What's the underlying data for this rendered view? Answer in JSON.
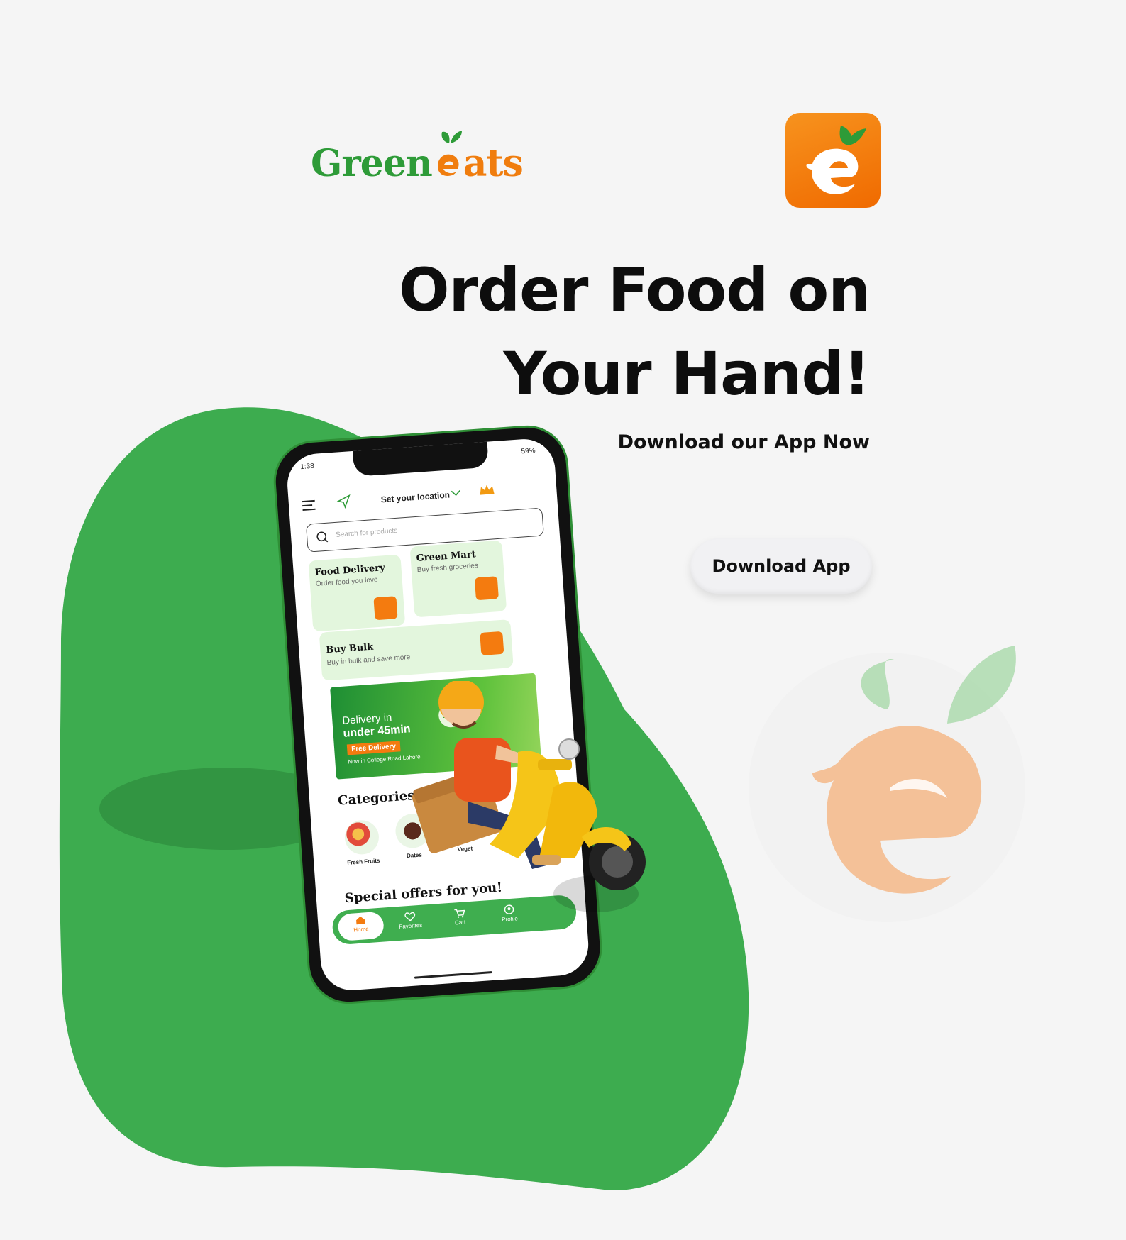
{
  "brand": {
    "wordmark_green": "Green",
    "wordmark_orange": "ats",
    "colors": {
      "green": "#3dac4f",
      "orange": "#f47b0f",
      "dark": "#0d0d0d"
    },
    "logo_icon": "bitten-fruit-e-icon"
  },
  "hero": {
    "headline_line1": "Order Food on",
    "headline_line2": "Your Hand!",
    "subline": "Download our App Now",
    "button_label": "Download App"
  },
  "phone": {
    "status_time": "1:38",
    "status_battery": "59%",
    "location_label": "Set your location",
    "search_placeholder": "Search for products",
    "cards": [
      {
        "title": "Food Delivery",
        "subtitle": "Order food you love"
      },
      {
        "title": "Green Mart",
        "subtitle": "Buy fresh groceries"
      },
      {
        "title": "Buy Bulk",
        "subtitle": "Buy in bulk and save more"
      }
    ],
    "banner": {
      "line1": "Delivery in",
      "line2": "under 45min",
      "tag": "Free Delivery",
      "note": "Now in College Road Lahore",
      "badge": "10/10"
    },
    "categories_title": "Categories",
    "categories": [
      "Fresh Fruits",
      "Dates",
      "Veget"
    ],
    "offers_title": "Special offers for you!",
    "nav": [
      "Home",
      "Favorites",
      "Cart",
      "Profile"
    ]
  }
}
